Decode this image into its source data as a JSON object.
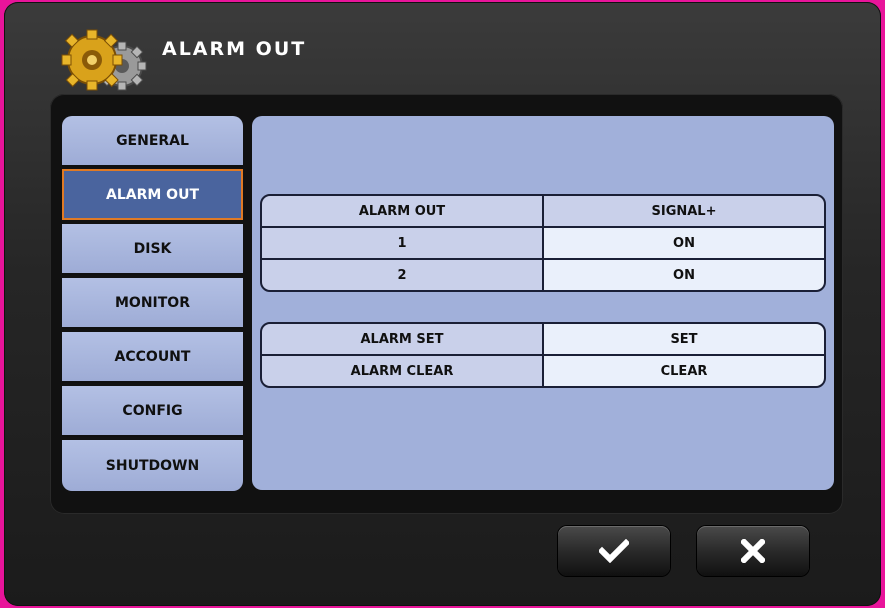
{
  "window": {
    "title": "ALARM OUT",
    "icon": "gears-icon"
  },
  "sidebar": {
    "items": [
      {
        "label": "GENERAL"
      },
      {
        "label": "ALARM OUT",
        "active": true
      },
      {
        "label": "DISK"
      },
      {
        "label": "MONITOR"
      },
      {
        "label": "ACCOUNT"
      },
      {
        "label": "CONFIG"
      },
      {
        "label": "SHUTDOWN"
      }
    ]
  },
  "alarm_table": {
    "headers": [
      "ALARM OUT",
      "SIGNAL+"
    ],
    "rows": [
      [
        "1",
        "ON"
      ],
      [
        "2",
        "ON"
      ]
    ]
  },
  "action_table": {
    "rows": [
      [
        "ALARM SET",
        "SET"
      ],
      [
        "ALARM CLEAR",
        "CLEAR"
      ]
    ]
  },
  "buttons": {
    "ok_icon": "checkmark-icon",
    "cancel_icon": "close-icon"
  },
  "colors": {
    "panel": "#a1b0da",
    "active_tab": "#4a649e",
    "active_border": "#e07a25"
  }
}
